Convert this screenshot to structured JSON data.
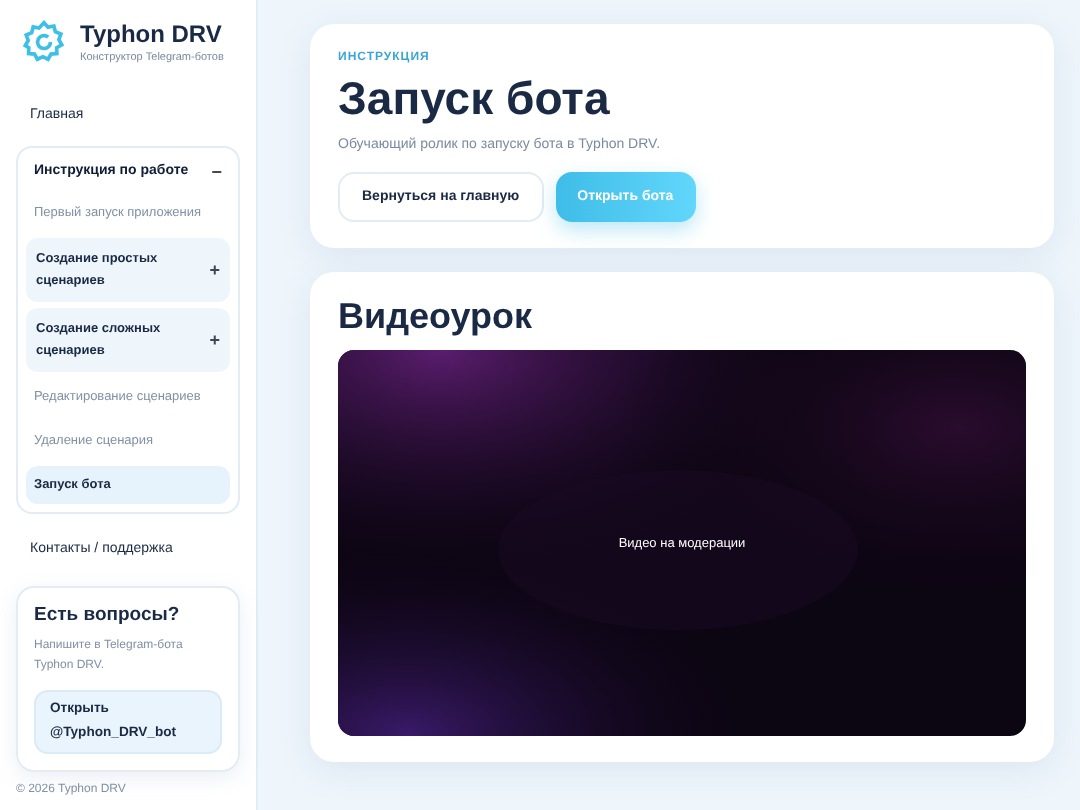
{
  "brand": {
    "name": "Typhon DRV",
    "tagline": "Конструктор Telegram-ботов"
  },
  "sidebar": {
    "items": [
      {
        "kind": "link",
        "label": "Главная",
        "selected": false
      },
      {
        "kind": "group",
        "label": "Инструкция по работе",
        "expanded": true,
        "toggle": "−",
        "children": [
          {
            "kind": "link",
            "label": "Первый запуск приложения",
            "selected": false
          },
          {
            "kind": "group",
            "label": "Создание простых сценариев",
            "expanded": false,
            "toggle": "+"
          },
          {
            "kind": "group",
            "label": "Создание сложных сценариев",
            "expanded": false,
            "toggle": "+"
          },
          {
            "kind": "link",
            "label": "Редактирование сценариев",
            "selected": false
          },
          {
            "kind": "link",
            "label": "Удаление сценария",
            "selected": false
          },
          {
            "kind": "link",
            "label": "Запуск бота",
            "selected": true
          }
        ]
      },
      {
        "kind": "link",
        "label": "Контакты / поддержка",
        "selected": false
      }
    ]
  },
  "help": {
    "title": "Есть вопросы?",
    "text": "Напишите в Telegram-бота Typhon DRV.",
    "button": "Открыть @Typhon_DRV_bot"
  },
  "copyright": "© 2026 Typhon DRV",
  "hero": {
    "eyebrow": "ИНСТРУКЦИЯ",
    "title": "Запуск бота",
    "subtitle": "Обучающий ролик по запуску бота в Typhon DRV.",
    "buttons": [
      {
        "label": "Вернуться на главную",
        "kind": "secondary"
      },
      {
        "label": "Открыть бота",
        "kind": "primary"
      }
    ]
  },
  "video": {
    "title": "Видеоурок",
    "status": "Видео на модерации",
    "kind": "picture"
  }
}
